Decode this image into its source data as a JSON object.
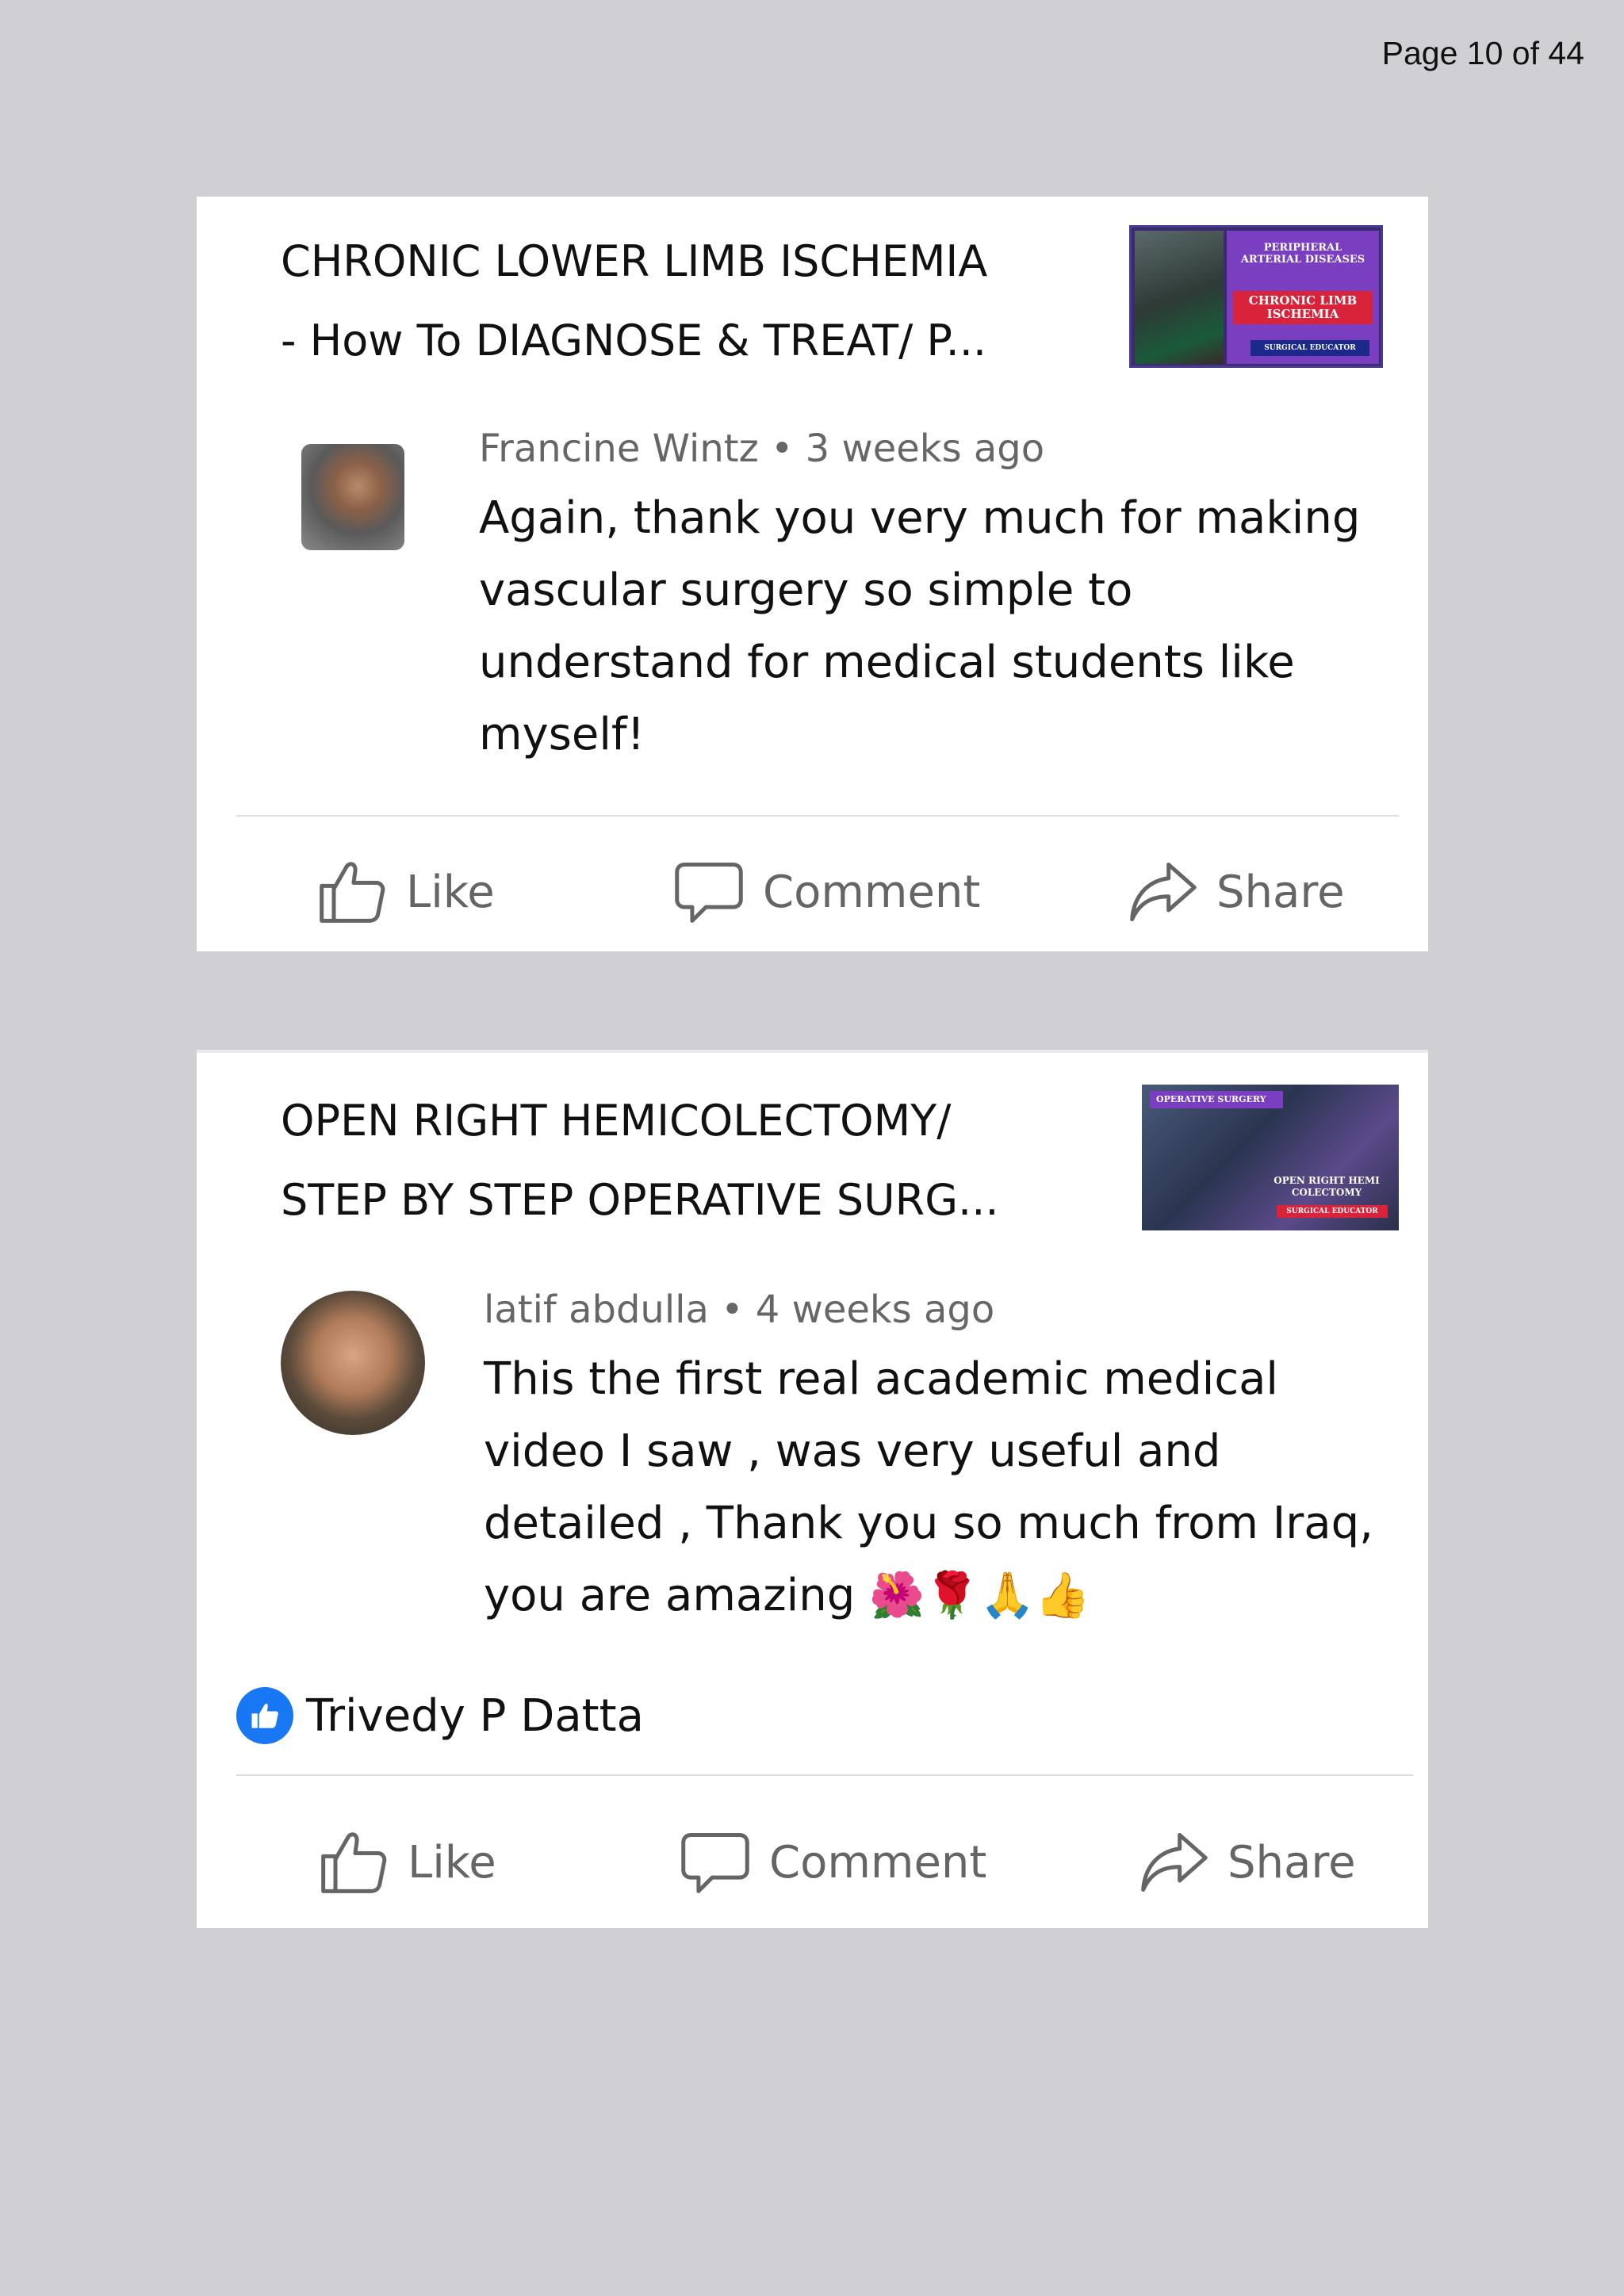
{
  "page": {
    "number_label": "Page 10 of 44"
  },
  "posts": [
    {
      "video_title_line1": "CHRONIC LOWER LIMB ISCHEMIA",
      "video_title_line2": "-  How To DIAGNOSE & TREAT/ P...",
      "thumbnail": {
        "text_top": "PERIPHERAL\nARTERIAL DISEASES",
        "text_middle": "CHRONIC LIMB\nISCHEMIA",
        "text_bottom": "SURGICAL EDUCATOR"
      },
      "comment": {
        "author": "Francine Wintz",
        "time": "3 weeks ago",
        "text": "Again, thank you very much for making vascular surgery so simple to understand for medical students like myself!"
      },
      "actions": {
        "like": "Like",
        "comment": "Comment",
        "share": "Share"
      }
    },
    {
      "video_title_line1": "OPEN RIGHT HEMICOLECTOMY/",
      "video_title_line2": "STEP BY STEP OPERATIVE SURG...",
      "thumbnail": {
        "text_top": "OPERATIVE SURGERY",
        "text_middle": "OPEN RIGHT HEMI\nCOLECTOMY",
        "text_bottom": "SURGICAL EDUCATOR"
      },
      "comment": {
        "author": "latif abdulla",
        "time": "4 weeks ago",
        "text": "This the first real academic medical video I saw , was very useful and detailed , Thank you so much from Iraq, you are amazing 🌺🌹🙏👍"
      },
      "liked_by": "Trivedy P Datta",
      "actions": {
        "like": "Like",
        "comment": "Comment",
        "share": "Share"
      }
    }
  ],
  "icons": {
    "like": "thumbs-up-icon",
    "comment": "speech-bubble-icon",
    "share": "share-arrow-icon",
    "liked": "blue-like-badge-icon"
  },
  "colors": {
    "background": "#d0cfd3",
    "card": "#ffffff",
    "action_text": "#656565",
    "like_badge": "#1877f2"
  }
}
